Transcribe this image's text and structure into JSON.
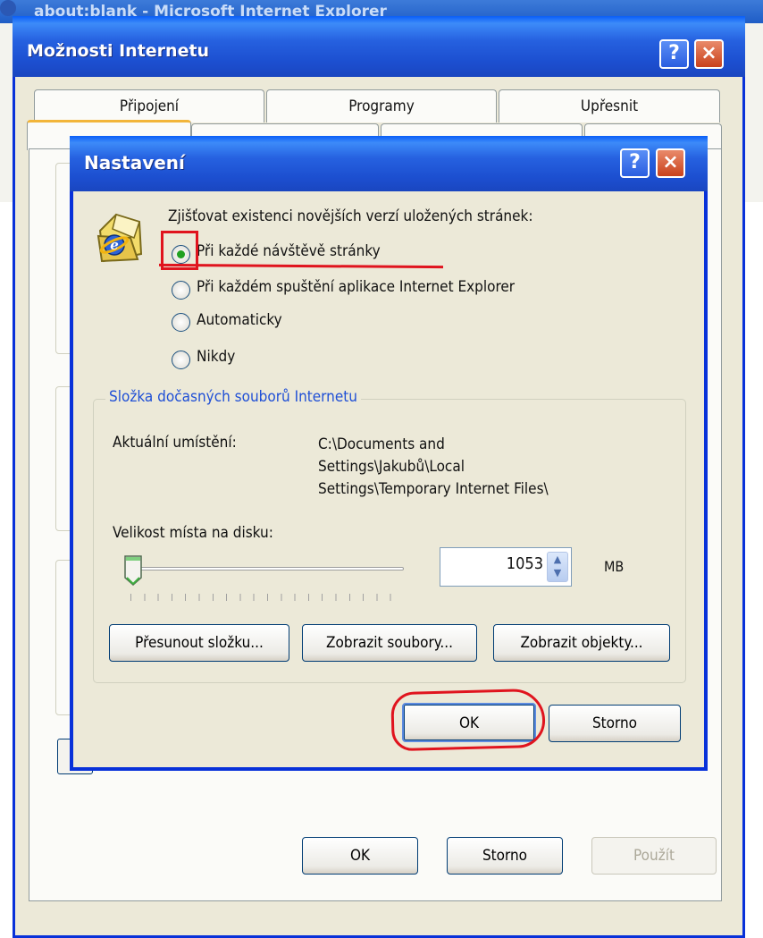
{
  "background_window": {
    "title": "about:blank - Microsoft Internet Explorer"
  },
  "outer_dialog": {
    "title": "Možnosti Internetu",
    "help_button": "?",
    "close_button": "×",
    "tabs_row1": [
      "Připojení",
      "Programy",
      "Upřesnit"
    ],
    "buttons": {
      "ok": "OK",
      "cancel": "Storno",
      "apply": "Použít"
    }
  },
  "inner_dialog": {
    "title": "Nastavení",
    "help_button": "?",
    "close_button": "×",
    "check_label": "Zjišťovat existenci novějších verzí uložených stránek:",
    "radio_options": [
      {
        "label": "Při každé návštěvě stránky",
        "selected": true
      },
      {
        "label": "Při každém spuštění aplikace Internet Explorer",
        "selected": false
      },
      {
        "label": "Automaticky",
        "selected": false
      },
      {
        "label": "Nikdy",
        "selected": false
      }
    ],
    "group": {
      "title": "Složka dočasných souborů Internetu",
      "location_label": "Aktuální umístění:",
      "location_value": "C:\\Documents and\nSettings\\Jakubů\\Local\nSettings\\Temporary Internet Files\\",
      "size_label": "Velikost místa na disku:",
      "size_value": "1053",
      "size_unit": "MB",
      "slider_level": 0.02
    },
    "buttons": {
      "move_folder": "Přesunout složku...",
      "view_files": "Zobrazit soubory...",
      "view_objects": "Zobrazit objekty...",
      "ok": "OK",
      "cancel": "Storno"
    }
  },
  "annotations": {
    "color": "#e0141e"
  }
}
